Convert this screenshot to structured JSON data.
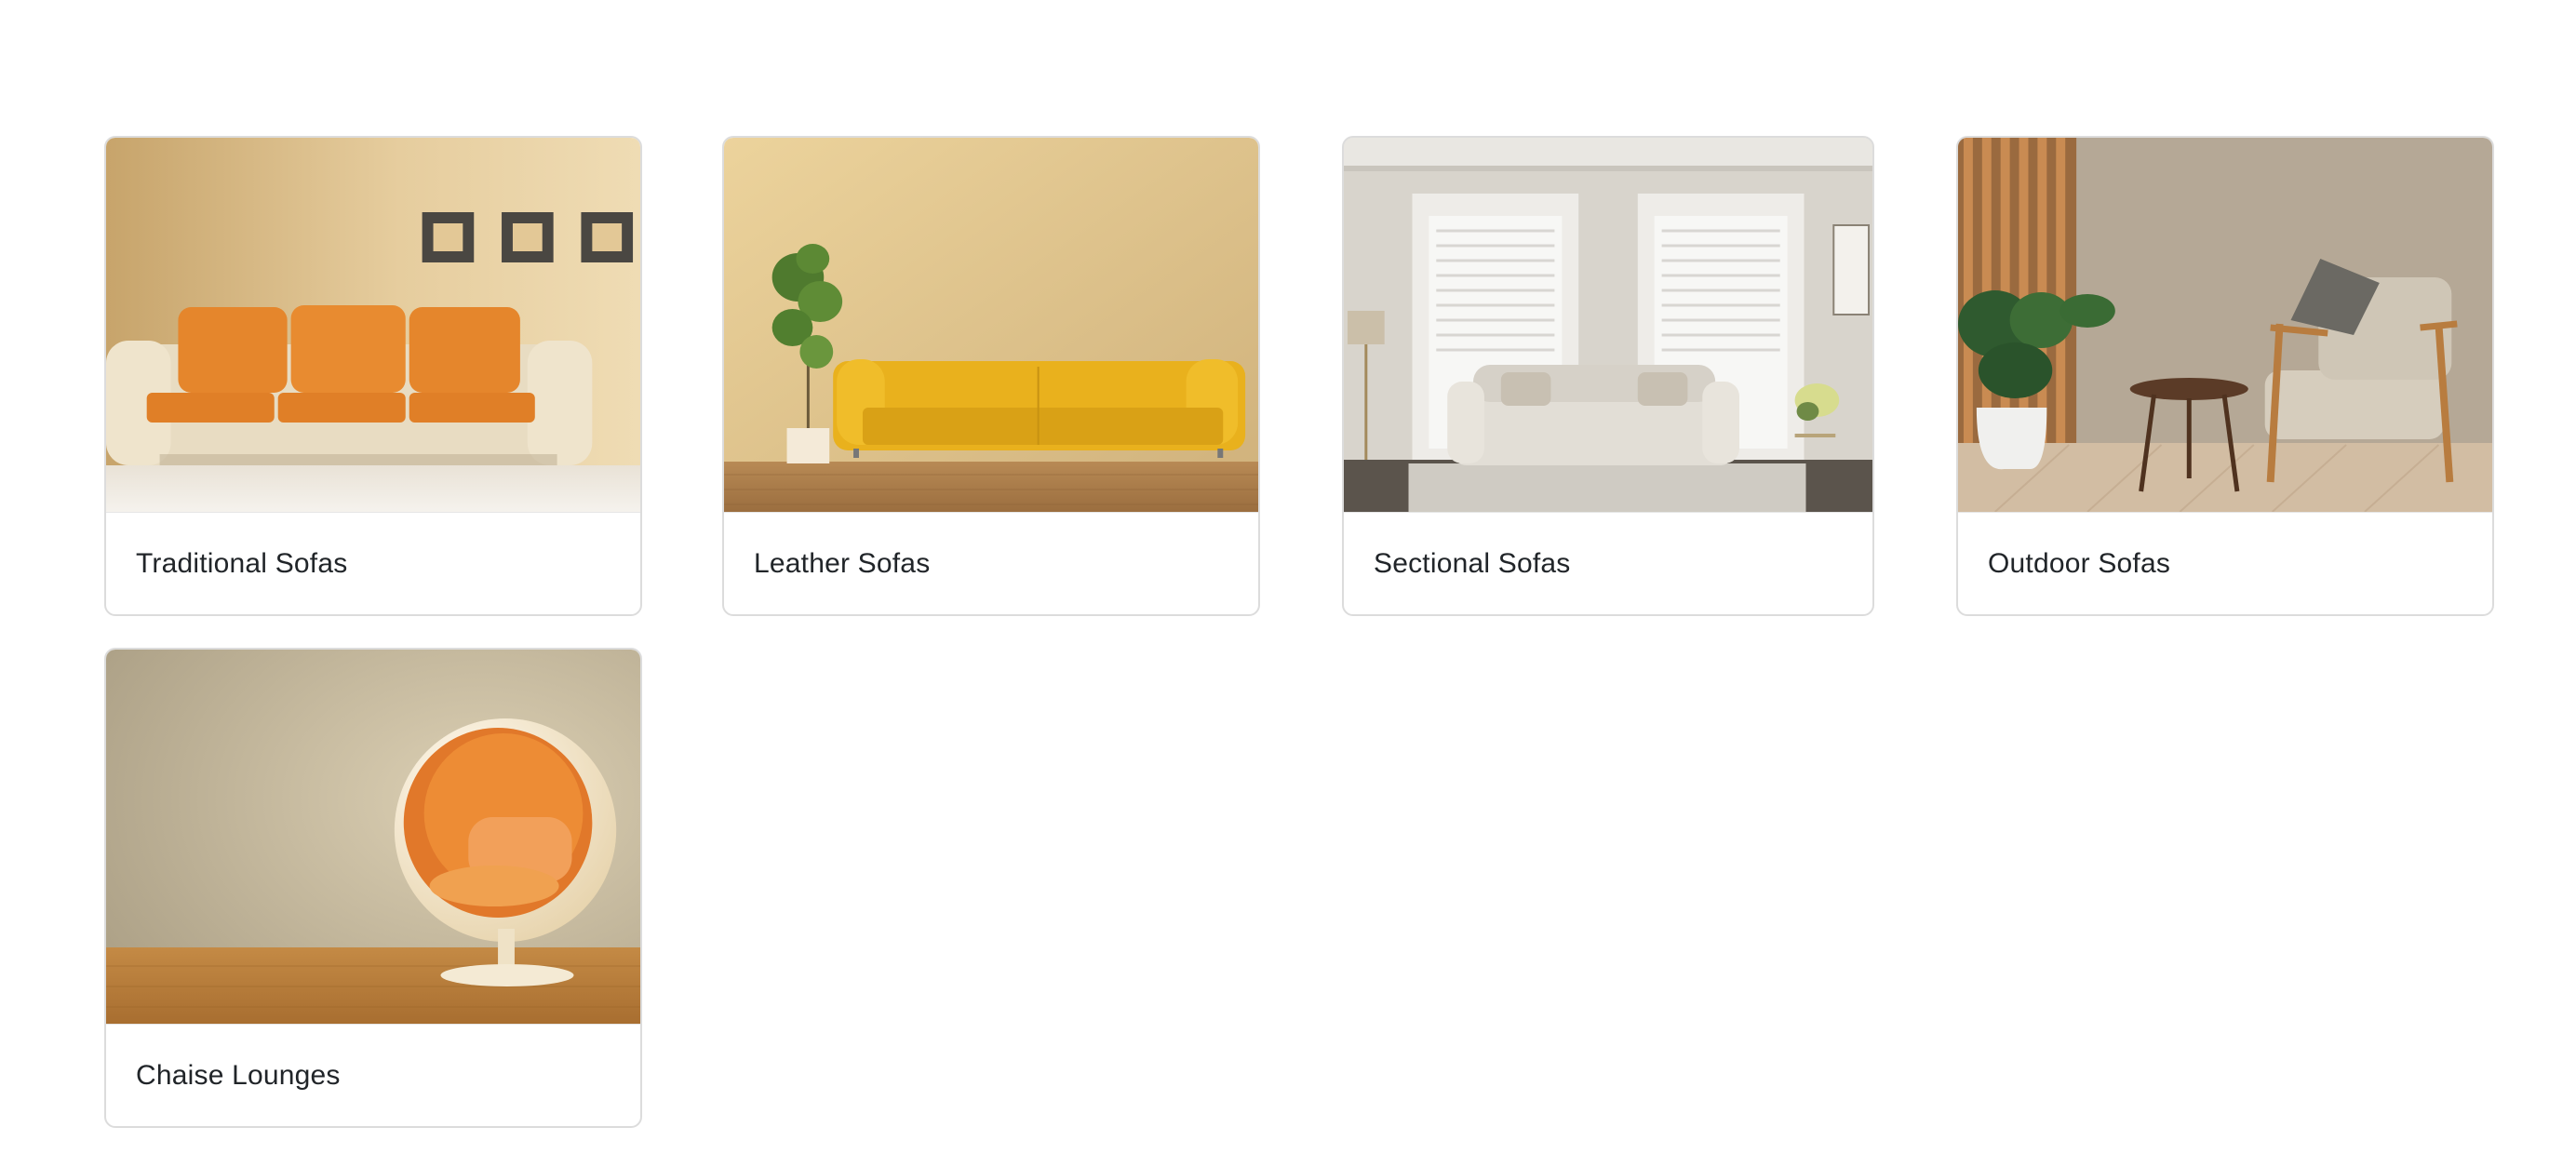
{
  "categories": [
    {
      "label": "Traditional Sofas",
      "image_subject": "orange-traditional-sofa-image"
    },
    {
      "label": "Leather Sofas",
      "image_subject": "yellow-leather-sofa-image"
    },
    {
      "label": "Sectional Sofas",
      "image_subject": "grey-tufted-sofa-room-image"
    },
    {
      "label": "Outdoor Sofas",
      "image_subject": "armchair-with-plant-image"
    },
    {
      "label": "Chaise Lounges",
      "image_subject": "egg-chair-image"
    }
  ]
}
